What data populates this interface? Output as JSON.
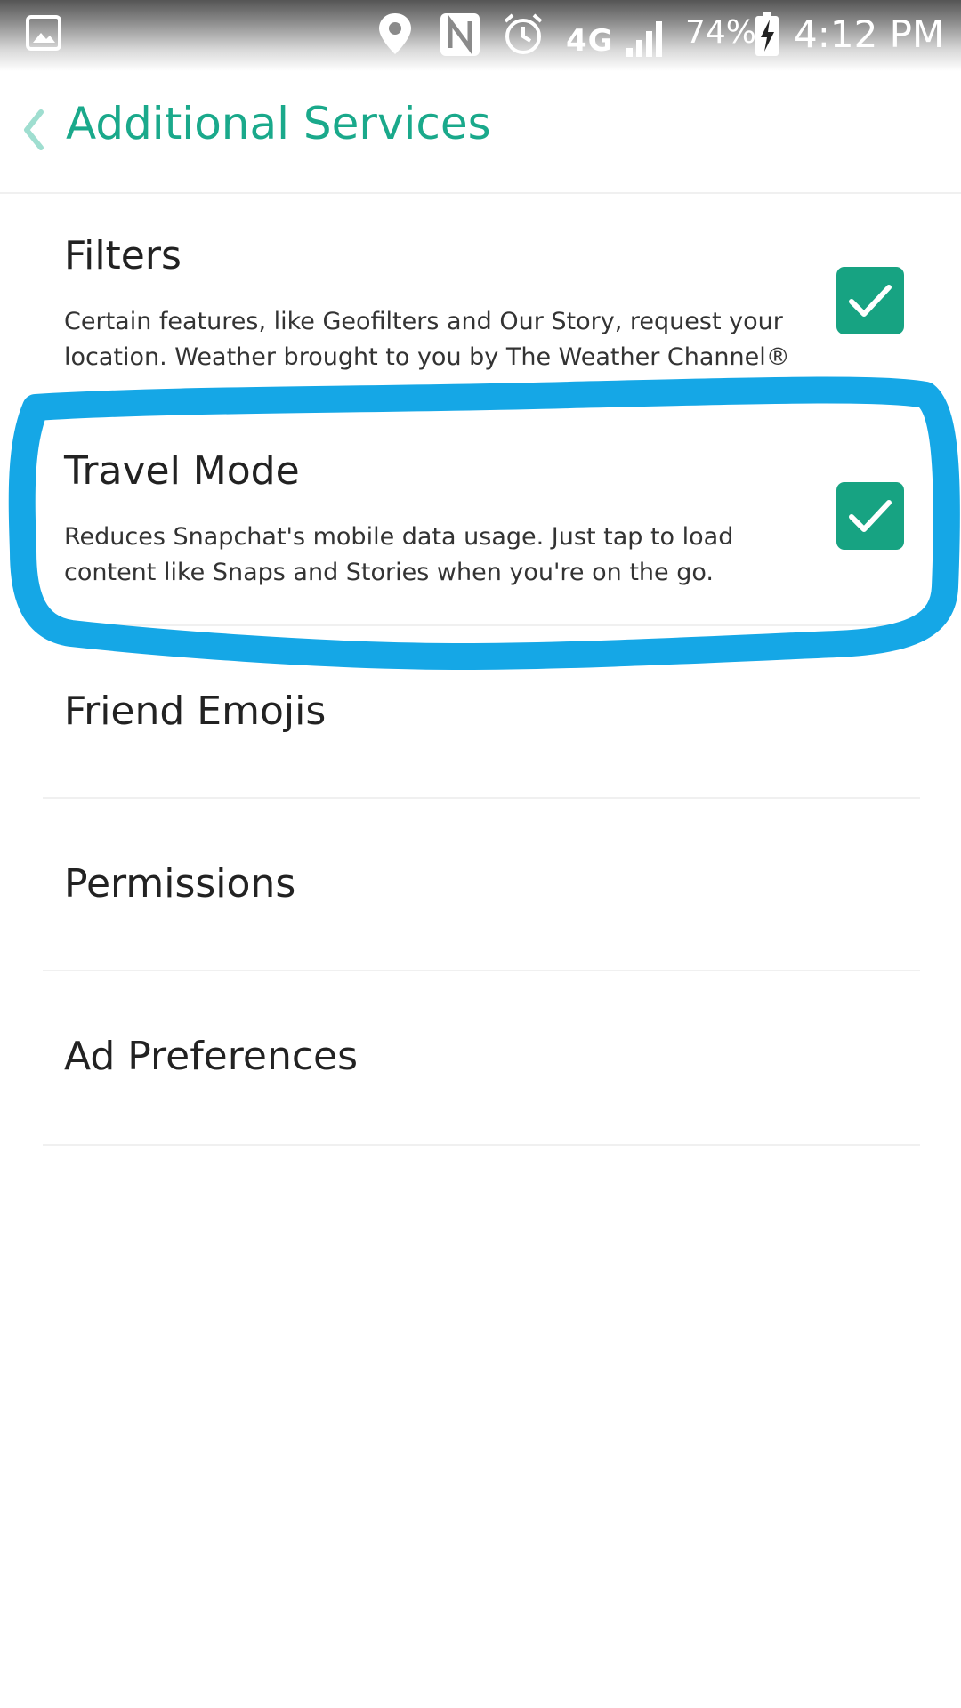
{
  "status_bar": {
    "network": "4G",
    "battery_percent": "74%",
    "time": "4:12 PM",
    "icons": [
      "gallery-icon",
      "location-icon",
      "nfc-icon",
      "alarm-icon",
      "signal-icon",
      "battery-charging-icon"
    ]
  },
  "header": {
    "back_icon": "chevron-left-icon",
    "title": "Additional Services"
  },
  "settings": [
    {
      "title": "Filters",
      "description": "Certain features, like Geofilters and Our Story, request your location. Weather brought to you by The Weather Channel®",
      "checked": true
    },
    {
      "title": "Travel Mode",
      "description": "Reduces Snapchat's mobile data usage. Just tap to load content like Snaps and Stories when you're on the go.",
      "checked": true
    },
    {
      "title": "Friend Emojis"
    },
    {
      "title": "Permissions"
    },
    {
      "title": "Ad Preferences"
    }
  ],
  "colors": {
    "accent": "#1aa98b",
    "checkbox": "#17a382",
    "annotation_stroke": "#15a7e6"
  }
}
